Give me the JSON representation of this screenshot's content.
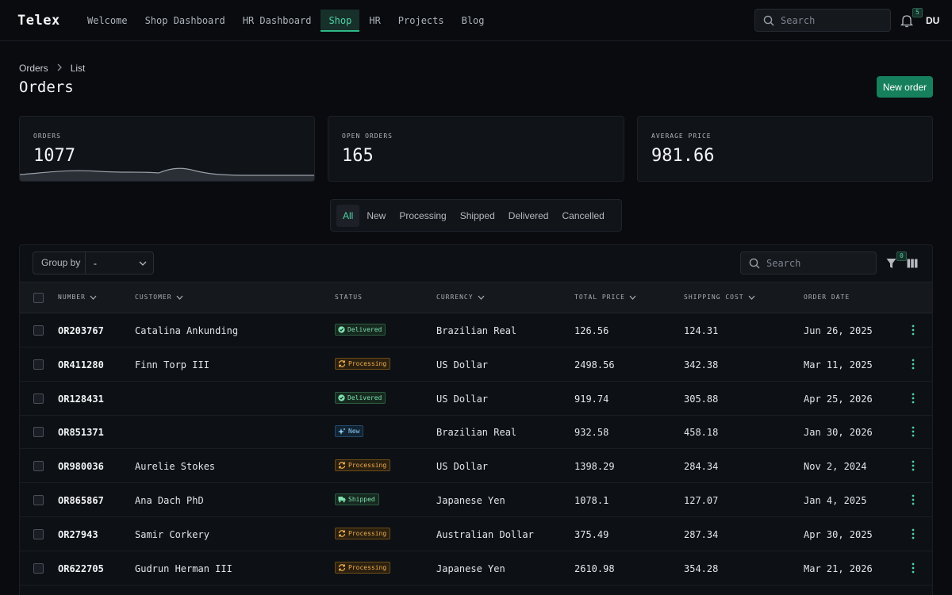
{
  "app": {
    "brand": "Telex"
  },
  "nav": [
    {
      "label": "Welcome",
      "active": false
    },
    {
      "label": "Shop Dashboard",
      "active": false
    },
    {
      "label": "HR Dashboard",
      "active": false
    },
    {
      "label": "Shop",
      "active": true
    },
    {
      "label": "HR",
      "active": false
    },
    {
      "label": "Projects",
      "active": false
    },
    {
      "label": "Blog",
      "active": false
    }
  ],
  "top_search": {
    "placeholder": "Search"
  },
  "notifications": {
    "count": "5"
  },
  "user": {
    "initials": "DU"
  },
  "breadcrumb": {
    "root": "Orders",
    "current": "List"
  },
  "page": {
    "title": "Orders",
    "new_button": "New order"
  },
  "stats": [
    {
      "label": "ORDERS",
      "value": "1077"
    },
    {
      "label": "OPEN ORDERS",
      "value": "165"
    },
    {
      "label": "AVERAGE PRICE",
      "value": "981.66"
    }
  ],
  "tabs": [
    "All",
    "New",
    "Processing",
    "Shipped",
    "Delivered",
    "Cancelled"
  ],
  "active_tab": "All",
  "toolbar": {
    "group_label": "Group by",
    "group_value": "-",
    "search_placeholder": "Search",
    "filter_count": "0"
  },
  "columns": {
    "number": "NUMBER",
    "customer": "CUSTOMER",
    "status": "STATUS",
    "currency": "CURRENCY",
    "total_price": "TOTAL PRICE",
    "shipping_cost": "SHIPPING COST",
    "order_date": "ORDER DATE"
  },
  "orders": [
    {
      "number": "OR203767",
      "customer": "Catalina Ankunding",
      "status": "Delivered",
      "currency": "Brazilian Real",
      "total": "126.56",
      "shipping": "124.31",
      "date": "Jun 26, 2025"
    },
    {
      "number": "OR411280",
      "customer": "Finn Torp III",
      "status": "Processing",
      "currency": "US Dollar",
      "total": "2498.56",
      "shipping": "342.38",
      "date": "Mar 11, 2025"
    },
    {
      "number": "OR128431",
      "customer": "",
      "status": "Delivered",
      "currency": "US Dollar",
      "total": "919.74",
      "shipping": "305.88",
      "date": "Apr 25, 2026"
    },
    {
      "number": "OR851371",
      "customer": "",
      "status": "New",
      "currency": "Brazilian Real",
      "total": "932.58",
      "shipping": "458.18",
      "date": "Jan 30, 2026"
    },
    {
      "number": "OR980036",
      "customer": "Aurelie Stokes",
      "status": "Processing",
      "currency": "US Dollar",
      "total": "1398.29",
      "shipping": "284.34",
      "date": "Nov 2, 2024"
    },
    {
      "number": "OR865867",
      "customer": "Ana Dach PhD",
      "status": "Shipped",
      "currency": "Japanese Yen",
      "total": "1078.1",
      "shipping": "127.07",
      "date": "Jan 4, 2025"
    },
    {
      "number": "OR27943",
      "customer": "Samir Corkery",
      "status": "Processing",
      "currency": "Australian Dollar",
      "total": "375.49",
      "shipping": "287.34",
      "date": "Apr 30, 2025"
    },
    {
      "number": "OR622705",
      "customer": "Gudrun Herman III",
      "status": "Processing",
      "currency": "Japanese Yen",
      "total": "2610.98",
      "shipping": "354.28",
      "date": "Mar 21, 2026"
    }
  ]
}
